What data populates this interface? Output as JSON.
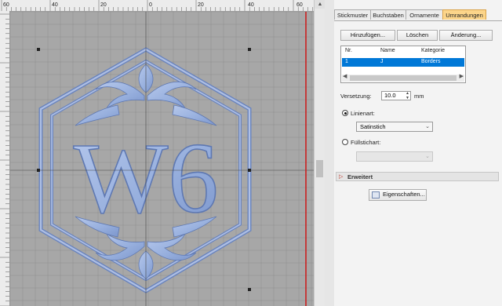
{
  "ruler": {
    "top_labels": [
      "60",
      "40",
      "20",
      "0",
      "20",
      "40",
      "60"
    ]
  },
  "tabs": [
    {
      "label": "Stickmuster",
      "active": false
    },
    {
      "label": "Buchstaben",
      "active": false
    },
    {
      "label": "Ornamente",
      "active": false
    },
    {
      "label": "Umrandungen",
      "active": true
    }
  ],
  "toolbar": {
    "add_label": "Hinzufügen...",
    "delete_label": "Löschen",
    "change_label": "Änderung..."
  },
  "table": {
    "headers": [
      "Nr.",
      "Name",
      "Kategorie"
    ],
    "rows": [
      {
        "nr": "1",
        "name": "J",
        "category": "Borders"
      }
    ]
  },
  "offset": {
    "label": "Versetzung:",
    "value": "10.0",
    "unit": "mm"
  },
  "line_type": {
    "label": "Linienart:",
    "selected": "Satinstich",
    "checked": true
  },
  "fill_type": {
    "label": "Füllstichart:",
    "selected": "",
    "checked": false
  },
  "section": {
    "label": "Erweitert"
  },
  "properties_button": {
    "label": "Eigenschaften..."
  },
  "design": {
    "monogram": "W6",
    "stitch_color": "#98b0de",
    "outline_color": "#5e78b2"
  },
  "colors": {
    "canvas_bg": "#a7a7a7",
    "grid": "#8f8f8f",
    "tab_active": "#fcd58a",
    "selection": "#0078d7",
    "hoop_line": "#cc1f1f"
  }
}
